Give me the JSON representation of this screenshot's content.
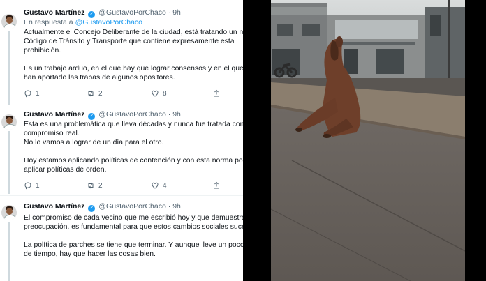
{
  "tweets": [
    {
      "author_name": "Gustavo Martínez",
      "handle": "@GustavoPorChaco",
      "time": "9h",
      "reply_prefix": "En respuesta a",
      "reply_mention": "@GustavoPorChaco",
      "lines": [
        "Actualmente el Concejo Deliberante de la ciudad, está tratando un nuevo",
        "Código de Tránsito y Transporte que contiene expresamente esta",
        "prohibición.",
        "",
        "Es un trabajo arduo, en el que hay que lograr consensos y en el que nada",
        "han aportado las trabas de algunos opositores."
      ],
      "replies": "1",
      "retweets": "2",
      "likes": "8"
    },
    {
      "author_name": "Gustavo Martínez",
      "handle": "@GustavoPorChaco",
      "time": "9h",
      "lines": [
        "Esta es una problemática que lleva décadas y nunca fue tratada con",
        "compromiso real.",
        "No lo vamos a lograr de un día para el otro.",
        "",
        "Hoy estamos aplicando políticas de contención y con esta norma podremos",
        "aplicar políticas de orden."
      ],
      "replies": "1",
      "retweets": "2",
      "likes": "4"
    },
    {
      "author_name": "Gustavo Martínez",
      "handle": "@GustavoPorChaco",
      "time": "9h",
      "lines": [
        "El compromiso de cada vecino que me escribió hoy y que demuestran su",
        "preocupación, es fundamental para que estos cambios sociales sucedan.",
        "",
        "La política de parches se tiene que terminar. Y aunque lleve un poco más",
        "de tiempo, hay que hacer las cosas bien."
      ]
    }
  ],
  "photo": {
    "icons": [
      "horse-photo",
      "building",
      "motorcycle",
      "sidewalk",
      "street"
    ]
  }
}
